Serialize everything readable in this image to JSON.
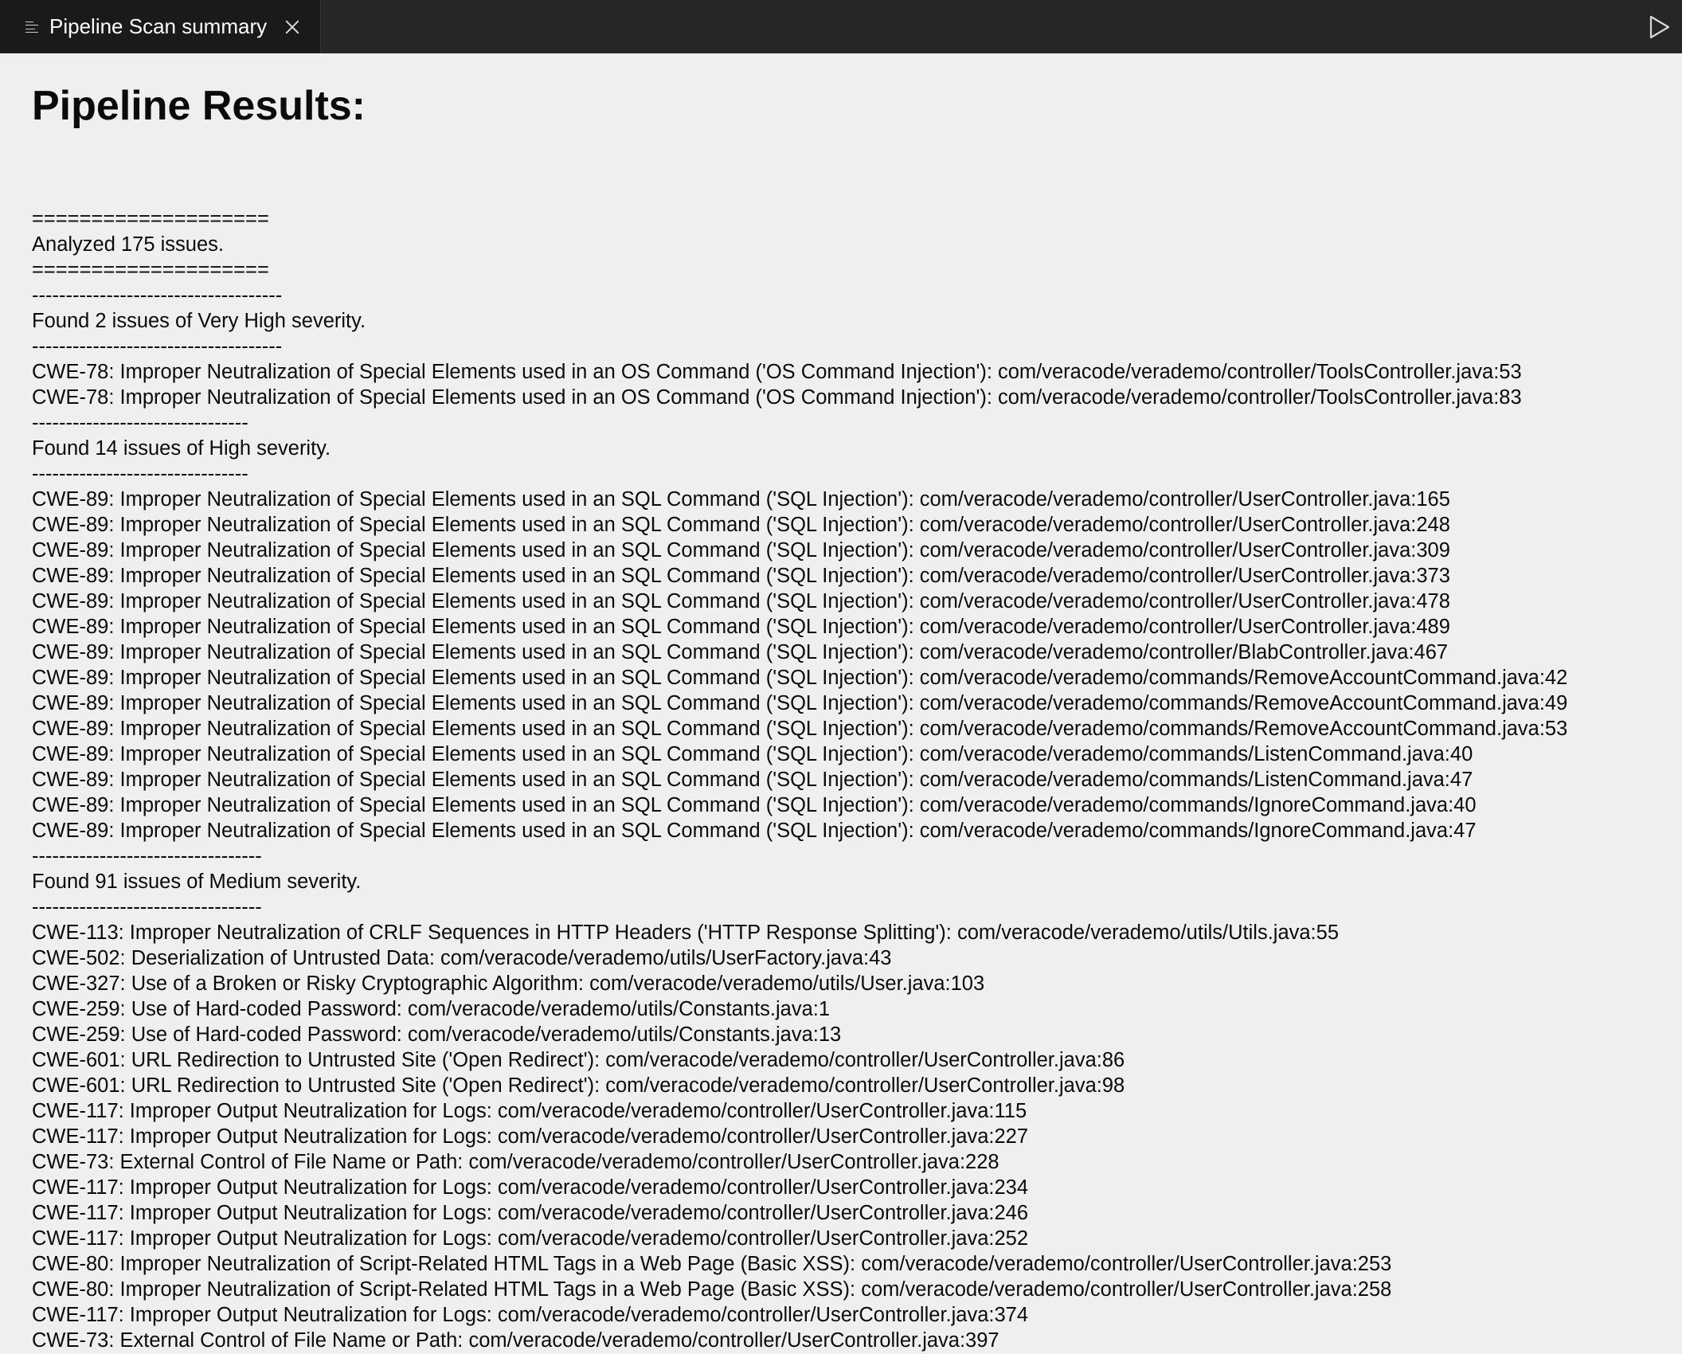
{
  "tab": {
    "title": "Pipeline Scan summary"
  },
  "heading": "Pipeline Results:",
  "lines": [
    "====================",
    "Analyzed 175 issues.",
    "====================",
    "-------------------------------------",
    "Found 2 issues of Very High severity.",
    "-------------------------------------",
    "CWE-78: Improper Neutralization of Special Elements used in an OS Command ('OS Command Injection'): com/veracode/verademo/controller/ToolsController.java:53",
    "CWE-78: Improper Neutralization of Special Elements used in an OS Command ('OS Command Injection'): com/veracode/verademo/controller/ToolsController.java:83",
    "--------------------------------",
    "Found 14 issues of High severity.",
    "--------------------------------",
    "CWE-89: Improper Neutralization of Special Elements used in an SQL Command ('SQL Injection'): com/veracode/verademo/controller/UserController.java:165",
    "CWE-89: Improper Neutralization of Special Elements used in an SQL Command ('SQL Injection'): com/veracode/verademo/controller/UserController.java:248",
    "CWE-89: Improper Neutralization of Special Elements used in an SQL Command ('SQL Injection'): com/veracode/verademo/controller/UserController.java:309",
    "CWE-89: Improper Neutralization of Special Elements used in an SQL Command ('SQL Injection'): com/veracode/verademo/controller/UserController.java:373",
    "CWE-89: Improper Neutralization of Special Elements used in an SQL Command ('SQL Injection'): com/veracode/verademo/controller/UserController.java:478",
    "CWE-89: Improper Neutralization of Special Elements used in an SQL Command ('SQL Injection'): com/veracode/verademo/controller/UserController.java:489",
    "CWE-89: Improper Neutralization of Special Elements used in an SQL Command ('SQL Injection'): com/veracode/verademo/controller/BlabController.java:467",
    "CWE-89: Improper Neutralization of Special Elements used in an SQL Command ('SQL Injection'): com/veracode/verademo/commands/RemoveAccountCommand.java:42",
    "CWE-89: Improper Neutralization of Special Elements used in an SQL Command ('SQL Injection'): com/veracode/verademo/commands/RemoveAccountCommand.java:49",
    "CWE-89: Improper Neutralization of Special Elements used in an SQL Command ('SQL Injection'): com/veracode/verademo/commands/RemoveAccountCommand.java:53",
    "CWE-89: Improper Neutralization of Special Elements used in an SQL Command ('SQL Injection'): com/veracode/verademo/commands/ListenCommand.java:40",
    "CWE-89: Improper Neutralization of Special Elements used in an SQL Command ('SQL Injection'): com/veracode/verademo/commands/ListenCommand.java:47",
    "CWE-89: Improper Neutralization of Special Elements used in an SQL Command ('SQL Injection'): com/veracode/verademo/commands/IgnoreCommand.java:40",
    "CWE-89: Improper Neutralization of Special Elements used in an SQL Command ('SQL Injection'): com/veracode/verademo/commands/IgnoreCommand.java:47",
    "----------------------------------",
    "Found 91 issues of Medium severity.",
    "----------------------------------",
    "CWE-113: Improper Neutralization of CRLF Sequences in HTTP Headers ('HTTP Response Splitting'): com/veracode/verademo/utils/Utils.java:55",
    "CWE-502: Deserialization of Untrusted Data: com/veracode/verademo/utils/UserFactory.java:43",
    "CWE-327: Use of a Broken or Risky Cryptographic Algorithm: com/veracode/verademo/utils/User.java:103",
    "CWE-259: Use of Hard-coded Password: com/veracode/verademo/utils/Constants.java:1",
    "CWE-259: Use of Hard-coded Password: com/veracode/verademo/utils/Constants.java:13",
    "CWE-601: URL Redirection to Untrusted Site ('Open Redirect'): com/veracode/verademo/controller/UserController.java:86",
    "CWE-601: URL Redirection to Untrusted Site ('Open Redirect'): com/veracode/verademo/controller/UserController.java:98",
    "CWE-117: Improper Output Neutralization for Logs: com/veracode/verademo/controller/UserController.java:115",
    "CWE-117: Improper Output Neutralization for Logs: com/veracode/verademo/controller/UserController.java:227",
    "CWE-73: External Control of File Name or Path: com/veracode/verademo/controller/UserController.java:228",
    "CWE-117: Improper Output Neutralization for Logs: com/veracode/verademo/controller/UserController.java:234",
    "CWE-117: Improper Output Neutralization for Logs: com/veracode/verademo/controller/UserController.java:246",
    "CWE-117: Improper Output Neutralization for Logs: com/veracode/verademo/controller/UserController.java:252",
    "CWE-80: Improper Neutralization of Script-Related HTML Tags in a Web Page (Basic XSS): com/veracode/verademo/controller/UserController.java:253",
    "CWE-80: Improper Neutralization of Script-Related HTML Tags in a Web Page (Basic XSS): com/veracode/verademo/controller/UserController.java:258",
    "CWE-117: Improper Output Neutralization for Logs: com/veracode/verademo/controller/UserController.java:374",
    "CWE-73: External Control of File Name or Path: com/veracode/verademo/controller/UserController.java:397"
  ]
}
